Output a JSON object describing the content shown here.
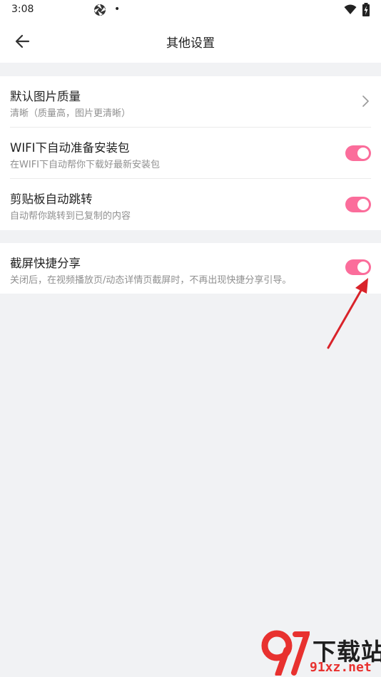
{
  "status_bar": {
    "time": "3:08",
    "dot": "•"
  },
  "app_bar": {
    "title": "其他设置"
  },
  "settings": [
    {
      "title": "默认图片质量",
      "subtitle": "清晰（质量高，图片更清晰）",
      "control": "chevron"
    },
    {
      "title": "WIFI下自动准备安装包",
      "subtitle": "在WIFI下自动帮你下载好最新安装包",
      "control": "toggle",
      "on": true
    },
    {
      "title": "剪贴板自动跳转",
      "subtitle": "自动帮你跳转到已复制的内容",
      "control": "toggle",
      "on": true
    },
    {
      "title": "截屏快捷分享",
      "subtitle": "关闭后，在视频播放页/动态详情页截屏时，不再出现快捷分享引导。",
      "control": "toggle",
      "on": true
    }
  ],
  "watermark": {
    "logo_text": "下载站",
    "site": "91xz.net"
  },
  "colors": {
    "accent": "#fb6d9b",
    "annotation": "#d9232a",
    "background": "#f1f2f4"
  }
}
